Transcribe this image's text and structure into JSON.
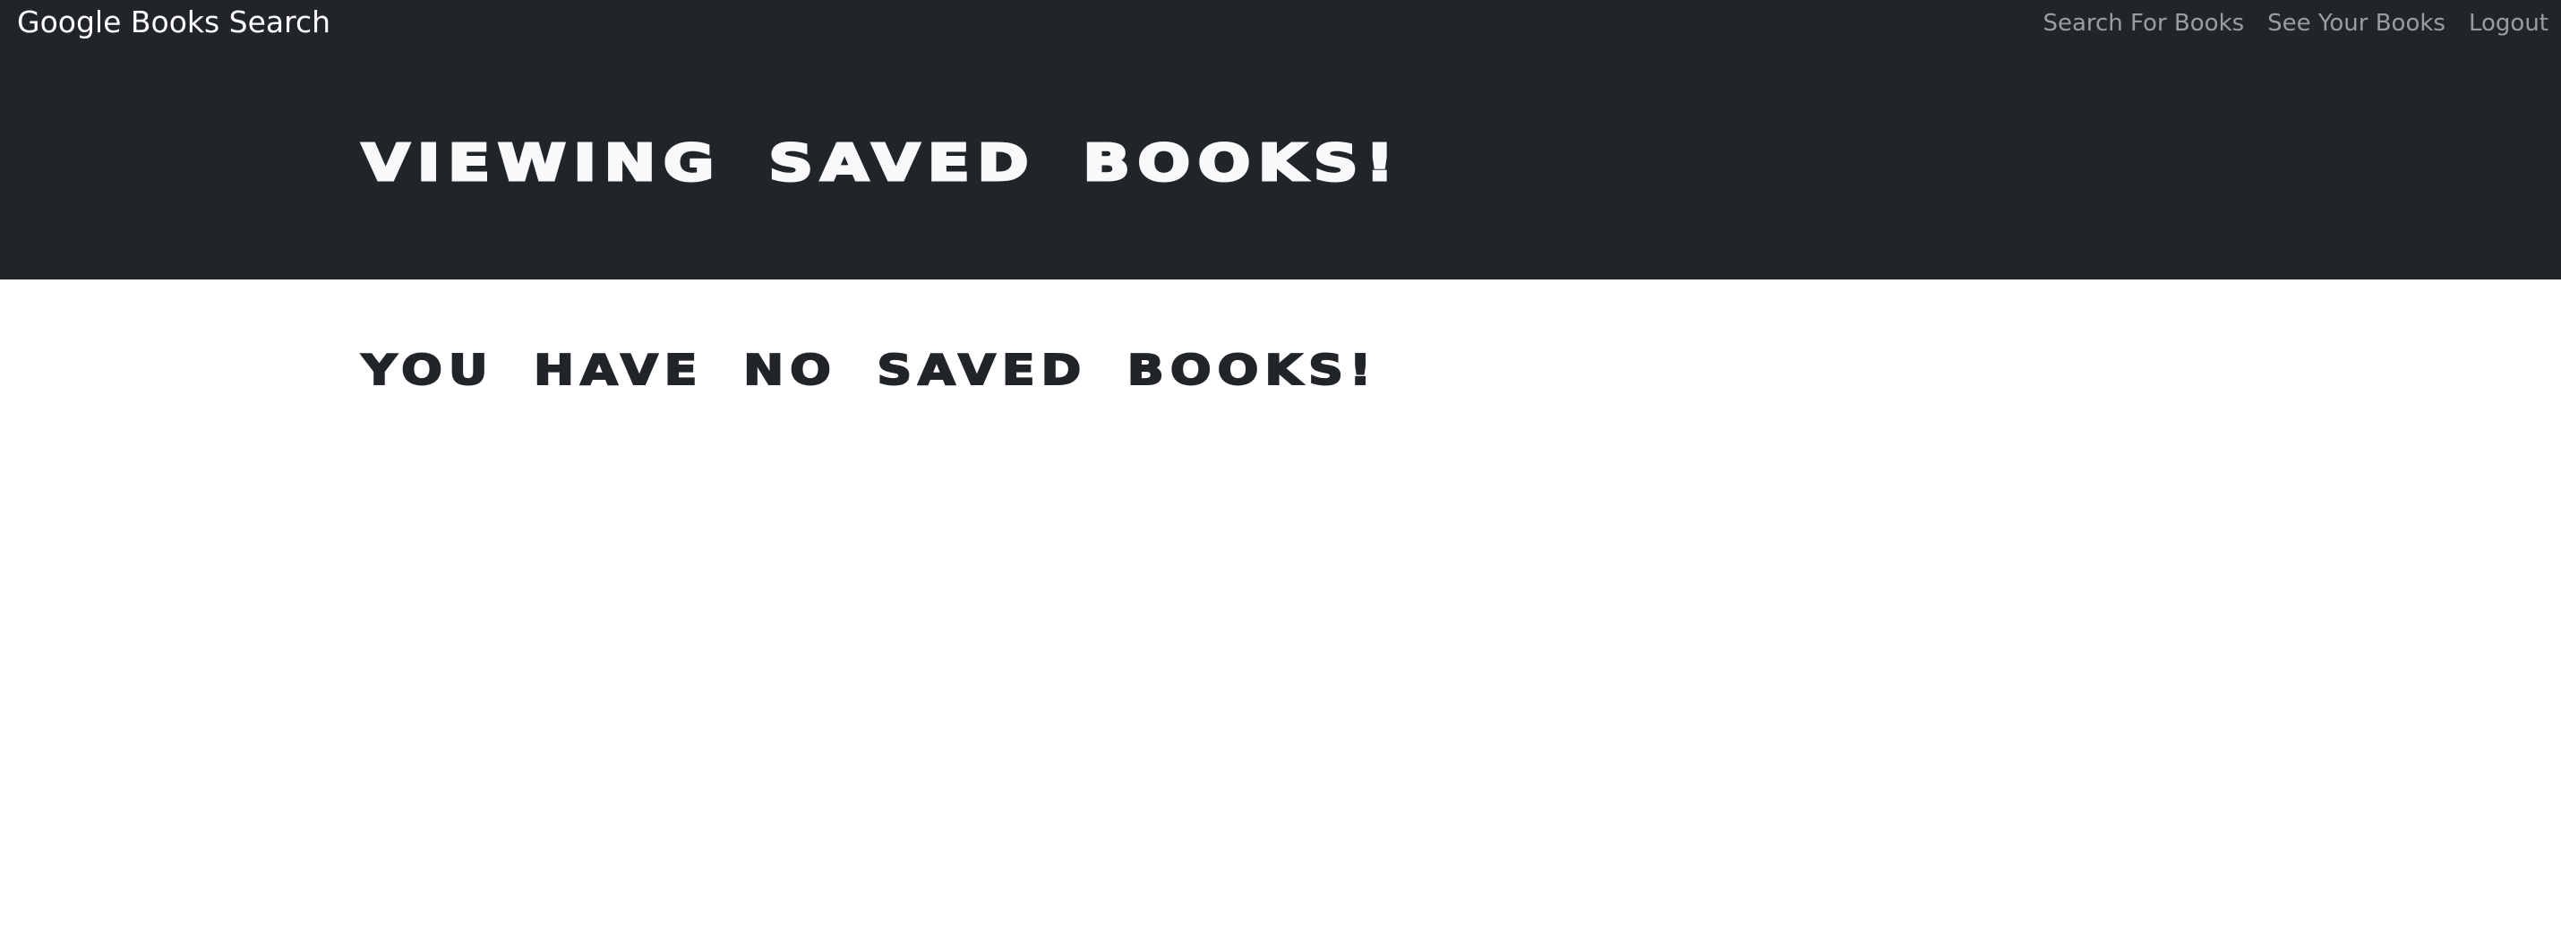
{
  "navbar": {
    "brand": "Google Books Search",
    "links": [
      {
        "label": "Search For Books"
      },
      {
        "label": "See Your Books"
      },
      {
        "label": "Logout"
      }
    ]
  },
  "hero": {
    "title": "Viewing saved books!"
  },
  "main": {
    "empty_message": "You have no saved books!"
  },
  "colors": {
    "navbar_bg": "#212529",
    "hero_text": "#f8f9fa",
    "nav_link": "rgba(255,255,255,0.55)",
    "body_text": "#212529"
  }
}
